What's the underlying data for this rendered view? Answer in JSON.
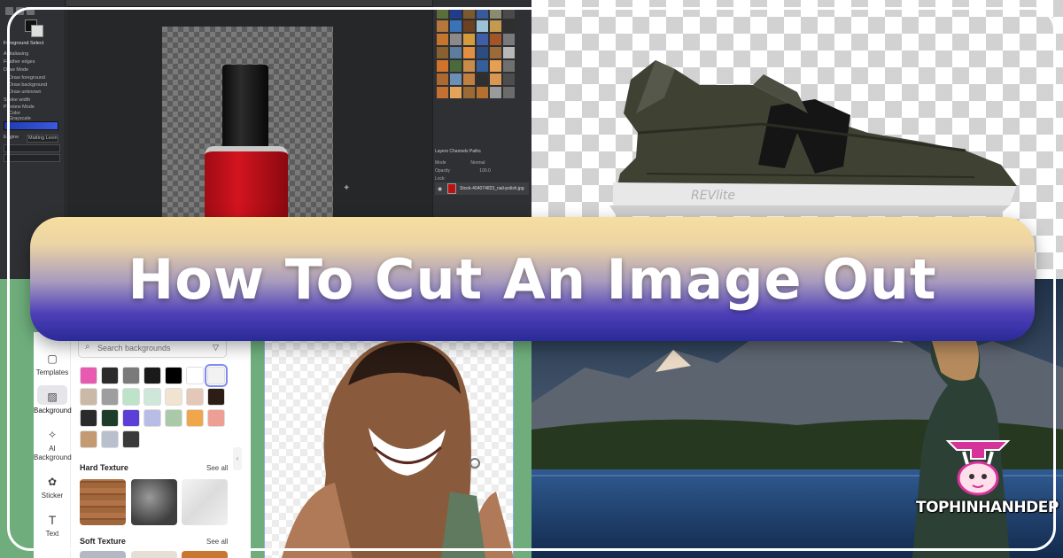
{
  "banner": {
    "title": "How To Cut An Image Out"
  },
  "brand": {
    "logo_text": "TOPHINHANHDEP",
    "accent": "#d6339a"
  },
  "colors": {
    "banner_top": "#f6dea0",
    "banner_bottom": "#2a2a98",
    "outer_border": "#ffffff"
  },
  "gimp": {
    "tool_options_title": "Foreground Select",
    "options": [
      "Antialiasing",
      "Feather edges",
      "Draw Mode",
      "Draw foreground",
      "Draw background",
      "Draw unknown",
      "Stroke width",
      "Preview Mode",
      "Color",
      "Grayscale",
      "Engine",
      "Matting Levin"
    ],
    "layers_tabs": "Layers   Channels   Paths",
    "mode_label": "Mode",
    "mode_value": "Normal",
    "opacity_label": "Opacity",
    "opacity_value": "100.0",
    "lock_label": "Lock:",
    "layer_name": "Stock-404074823_nail-polish.jpg"
  },
  "editor": {
    "search_placeholder": "Search backgrounds",
    "rail": [
      {
        "label": "Templates",
        "icon": "template-icon"
      },
      {
        "label": "Background",
        "icon": "background-icon"
      },
      {
        "label": "AI Background",
        "icon": "ai-background-icon"
      },
      {
        "label": "Sticker",
        "icon": "sticker-icon"
      },
      {
        "label": "Text",
        "icon": "text-icon"
      }
    ],
    "hard_texture_title": "Hard Texture",
    "soft_texture_title": "Soft Texture",
    "see_all": "See all",
    "swatch_colors": [
      "#e85ab0",
      "#2b2b2b",
      "#7a7a7a",
      "#1a1a1a",
      "#000000",
      "#ffffff",
      "#f2f2f2",
      "#c9b9a6",
      "#9e9e9e",
      "#bde3c9",
      "#cfe6da",
      "#f1e3cf",
      "#e4c7b7",
      "#2c1e16",
      "#2a2a2a",
      "#1d3d2a",
      "#5b3fd6",
      "#b8bde6",
      "#a9c9a8",
      "#f0a64a",
      "#ee9f95",
      "#c49a72",
      "#b7c0cc",
      "#3a3a3a"
    ]
  },
  "landscape": {}
}
